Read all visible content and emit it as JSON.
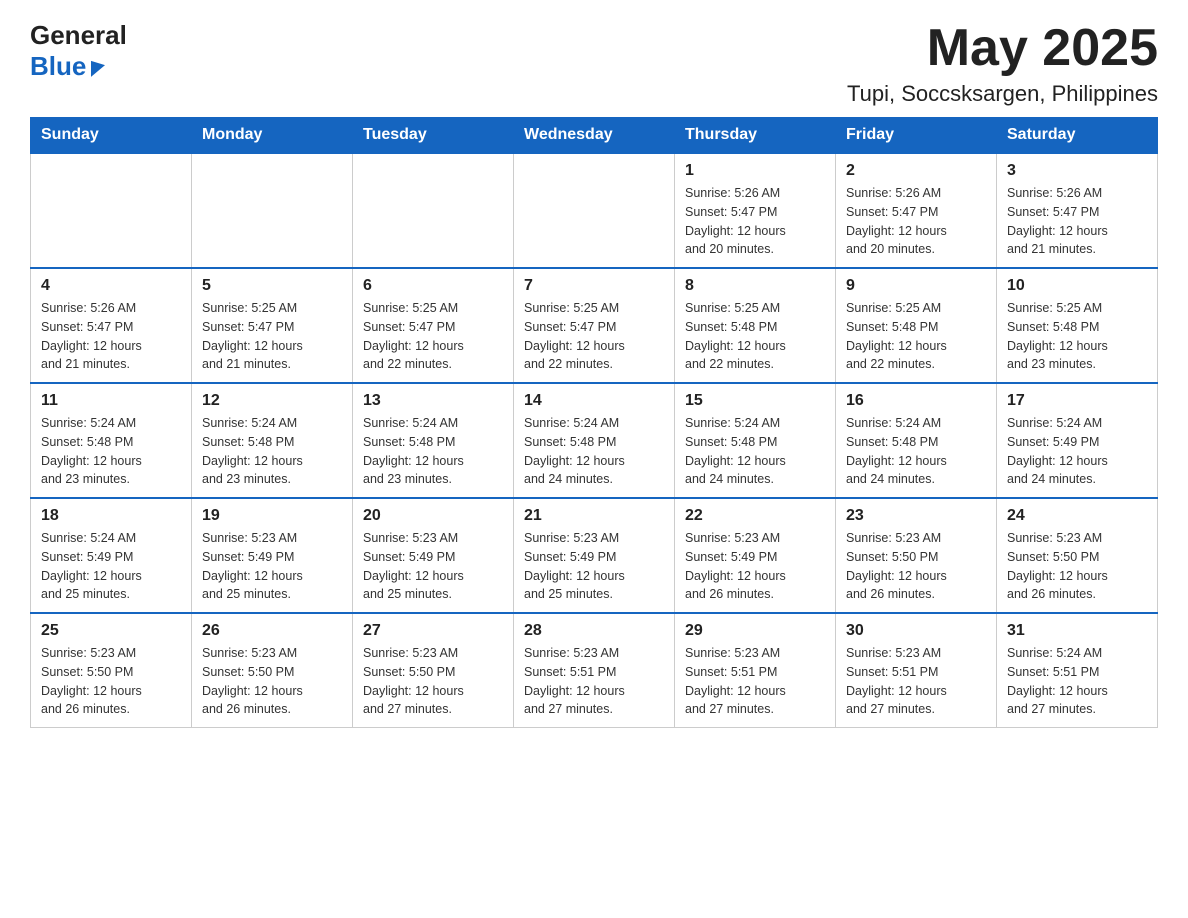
{
  "header": {
    "logo_line1": "General",
    "logo_line2": "Blue",
    "month_year": "May 2025",
    "location": "Tupi, Soccsksargen, Philippines"
  },
  "calendar": {
    "days_of_week": [
      "Sunday",
      "Monday",
      "Tuesday",
      "Wednesday",
      "Thursday",
      "Friday",
      "Saturday"
    ],
    "weeks": [
      [
        {
          "day": "",
          "info": ""
        },
        {
          "day": "",
          "info": ""
        },
        {
          "day": "",
          "info": ""
        },
        {
          "day": "",
          "info": ""
        },
        {
          "day": "1",
          "info": "Sunrise: 5:26 AM\nSunset: 5:47 PM\nDaylight: 12 hours\nand 20 minutes."
        },
        {
          "day": "2",
          "info": "Sunrise: 5:26 AM\nSunset: 5:47 PM\nDaylight: 12 hours\nand 20 minutes."
        },
        {
          "day": "3",
          "info": "Sunrise: 5:26 AM\nSunset: 5:47 PM\nDaylight: 12 hours\nand 21 minutes."
        }
      ],
      [
        {
          "day": "4",
          "info": "Sunrise: 5:26 AM\nSunset: 5:47 PM\nDaylight: 12 hours\nand 21 minutes."
        },
        {
          "day": "5",
          "info": "Sunrise: 5:25 AM\nSunset: 5:47 PM\nDaylight: 12 hours\nand 21 minutes."
        },
        {
          "day": "6",
          "info": "Sunrise: 5:25 AM\nSunset: 5:47 PM\nDaylight: 12 hours\nand 22 minutes."
        },
        {
          "day": "7",
          "info": "Sunrise: 5:25 AM\nSunset: 5:47 PM\nDaylight: 12 hours\nand 22 minutes."
        },
        {
          "day": "8",
          "info": "Sunrise: 5:25 AM\nSunset: 5:48 PM\nDaylight: 12 hours\nand 22 minutes."
        },
        {
          "day": "9",
          "info": "Sunrise: 5:25 AM\nSunset: 5:48 PM\nDaylight: 12 hours\nand 22 minutes."
        },
        {
          "day": "10",
          "info": "Sunrise: 5:25 AM\nSunset: 5:48 PM\nDaylight: 12 hours\nand 23 minutes."
        }
      ],
      [
        {
          "day": "11",
          "info": "Sunrise: 5:24 AM\nSunset: 5:48 PM\nDaylight: 12 hours\nand 23 minutes."
        },
        {
          "day": "12",
          "info": "Sunrise: 5:24 AM\nSunset: 5:48 PM\nDaylight: 12 hours\nand 23 minutes."
        },
        {
          "day": "13",
          "info": "Sunrise: 5:24 AM\nSunset: 5:48 PM\nDaylight: 12 hours\nand 23 minutes."
        },
        {
          "day": "14",
          "info": "Sunrise: 5:24 AM\nSunset: 5:48 PM\nDaylight: 12 hours\nand 24 minutes."
        },
        {
          "day": "15",
          "info": "Sunrise: 5:24 AM\nSunset: 5:48 PM\nDaylight: 12 hours\nand 24 minutes."
        },
        {
          "day": "16",
          "info": "Sunrise: 5:24 AM\nSunset: 5:48 PM\nDaylight: 12 hours\nand 24 minutes."
        },
        {
          "day": "17",
          "info": "Sunrise: 5:24 AM\nSunset: 5:49 PM\nDaylight: 12 hours\nand 24 minutes."
        }
      ],
      [
        {
          "day": "18",
          "info": "Sunrise: 5:24 AM\nSunset: 5:49 PM\nDaylight: 12 hours\nand 25 minutes."
        },
        {
          "day": "19",
          "info": "Sunrise: 5:23 AM\nSunset: 5:49 PM\nDaylight: 12 hours\nand 25 minutes."
        },
        {
          "day": "20",
          "info": "Sunrise: 5:23 AM\nSunset: 5:49 PM\nDaylight: 12 hours\nand 25 minutes."
        },
        {
          "day": "21",
          "info": "Sunrise: 5:23 AM\nSunset: 5:49 PM\nDaylight: 12 hours\nand 25 minutes."
        },
        {
          "day": "22",
          "info": "Sunrise: 5:23 AM\nSunset: 5:49 PM\nDaylight: 12 hours\nand 26 minutes."
        },
        {
          "day": "23",
          "info": "Sunrise: 5:23 AM\nSunset: 5:50 PM\nDaylight: 12 hours\nand 26 minutes."
        },
        {
          "day": "24",
          "info": "Sunrise: 5:23 AM\nSunset: 5:50 PM\nDaylight: 12 hours\nand 26 minutes."
        }
      ],
      [
        {
          "day": "25",
          "info": "Sunrise: 5:23 AM\nSunset: 5:50 PM\nDaylight: 12 hours\nand 26 minutes."
        },
        {
          "day": "26",
          "info": "Sunrise: 5:23 AM\nSunset: 5:50 PM\nDaylight: 12 hours\nand 26 minutes."
        },
        {
          "day": "27",
          "info": "Sunrise: 5:23 AM\nSunset: 5:50 PM\nDaylight: 12 hours\nand 27 minutes."
        },
        {
          "day": "28",
          "info": "Sunrise: 5:23 AM\nSunset: 5:51 PM\nDaylight: 12 hours\nand 27 minutes."
        },
        {
          "day": "29",
          "info": "Sunrise: 5:23 AM\nSunset: 5:51 PM\nDaylight: 12 hours\nand 27 minutes."
        },
        {
          "day": "30",
          "info": "Sunrise: 5:23 AM\nSunset: 5:51 PM\nDaylight: 12 hours\nand 27 minutes."
        },
        {
          "day": "31",
          "info": "Sunrise: 5:24 AM\nSunset: 5:51 PM\nDaylight: 12 hours\nand 27 minutes."
        }
      ]
    ]
  }
}
